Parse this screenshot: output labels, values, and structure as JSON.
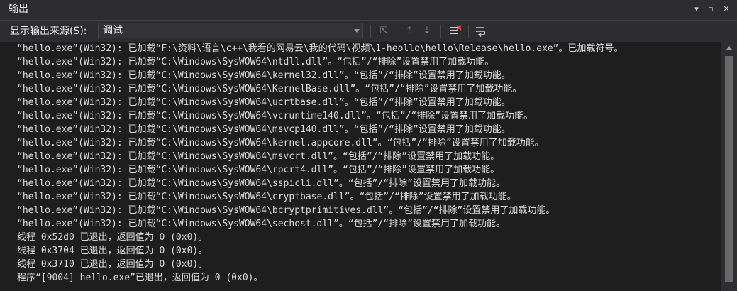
{
  "window": {
    "title": "输出",
    "dropdown_icon": "chevron-down-icon",
    "restore_icon": "restore-icon",
    "close_icon": "close-icon"
  },
  "toolbar": {
    "source_label": "显示输出来源(S):",
    "source_value": "调试",
    "icons": [
      "find-message-icon",
      "previous-message-icon",
      "next-message-icon",
      "clear-all-icon",
      "word-wrap-icon"
    ]
  },
  "output": {
    "lines": [
      "“hello.exe”(Win32): 已加载“F:\\资料\\语言\\c++\\我看的网易云\\我的代码\\视频\\1-heollo\\hello\\Release\\hello.exe”。已加载符号。",
      "“hello.exe”(Win32): 已加载“C:\\Windows\\SysWOW64\\ntdll.dll”。“包括”/“排除”设置禁用了加载功能。",
      "“hello.exe”(Win32): 已加载“C:\\Windows\\SysWOW64\\kernel32.dll”。“包括”/“排除”设置禁用了加载功能。",
      "“hello.exe”(Win32): 已加载“C:\\Windows\\SysWOW64\\KernelBase.dll”。“包括”/“排除”设置禁用了加载功能。",
      "“hello.exe”(Win32): 已加载“C:\\Windows\\SysWOW64\\ucrtbase.dll”。“包括”/“排除”设置禁用了加载功能。",
      "“hello.exe”(Win32): 已加载“C:\\Windows\\SysWOW64\\vcruntime140.dll”。“包括”/“排除”设置禁用了加载功能。",
      "“hello.exe”(Win32): 已加载“C:\\Windows\\SysWOW64\\msvcp140.dll”。“包括”/“排除”设置禁用了加载功能。",
      "“hello.exe”(Win32): 已加载“C:\\Windows\\SysWOW64\\kernel.appcore.dll”。“包括”/“排除”设置禁用了加载功能。",
      "“hello.exe”(Win32): 已加载“C:\\Windows\\SysWOW64\\msvcrt.dll”。“包括”/“排除”设置禁用了加载功能。",
      "“hello.exe”(Win32): 已加载“C:\\Windows\\SysWOW64\\rpcrt4.dll”。“包括”/“排除”设置禁用了加载功能。",
      "“hello.exe”(Win32): 已加载“C:\\Windows\\SysWOW64\\sspicli.dll”。“包括”/“排除”设置禁用了加载功能。",
      "“hello.exe”(Win32): 已加载“C:\\Windows\\SysWOW64\\cryptbase.dll”。“包括”/“排除”设置禁用了加载功能。",
      "“hello.exe”(Win32): 已加载“C:\\Windows\\SysWOW64\\bcryptprimitives.dll”。“包括”/“排除”设置禁用了加载功能。",
      "“hello.exe”(Win32): 已加载“C:\\Windows\\SysWOW64\\sechost.dll”。“包括”/“排除”设置禁用了加载功能。",
      "线程 0x52d0 已退出，返回值为 0 (0x0)。",
      "线程 0x3704 已退出，返回值为 0 (0x0)。",
      "线程 0x3710 已退出，返回值为 0 (0x0)。",
      "程序“[9004] hello.exe”已退出，返回值为 0 (0x0)。"
    ]
  }
}
